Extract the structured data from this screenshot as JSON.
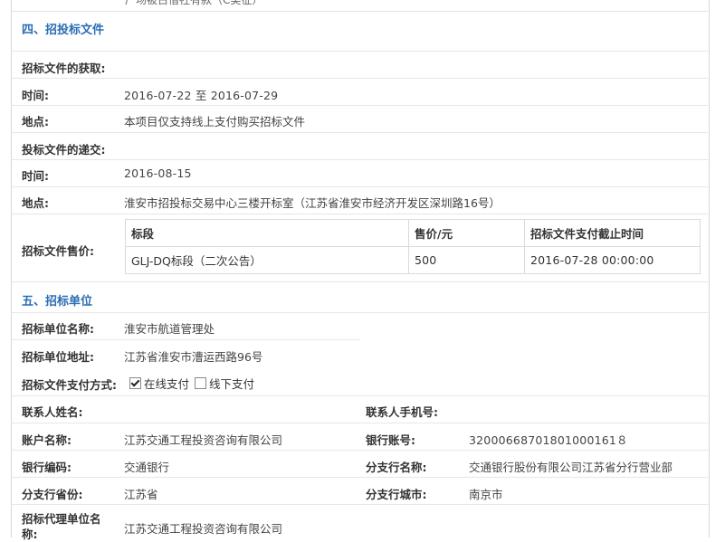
{
  "top_partial": "广场被占借社有款（C类征）",
  "section4": {
    "title": "四、招投标文件",
    "rows": {
      "get_label": "招标文件的获取:",
      "time_label": "时间:",
      "time_value": "2016-07-22 至 2016-07-29",
      "place_label": "地点:",
      "place_value": "本项目仅支持线上支付购买招标文件",
      "submit_label": "投标文件的递交:",
      "submit_time_label": "时间:",
      "submit_time_value": "2016-08-15",
      "submit_place_label": "地点:",
      "submit_place_value": "淮安市招投标交易中心三楼开标室（江苏省淮安市经济开发区深圳路16号）",
      "price_label": "招标文件售价:"
    },
    "fee_table": {
      "headers": [
        "标段",
        "售价/元",
        "招标文件支付截止时间"
      ],
      "rows": [
        [
          "GLJ-DQ标段（二次公告）",
          "500",
          "2016-07-28 00:00:00"
        ]
      ]
    }
  },
  "section5": {
    "title": "五、招标单位",
    "unit_name_label": "招标单位名称:",
    "unit_name_value": "淮安市航道管理处",
    "unit_addr_label": "招标单位地址:",
    "unit_addr_value": "江苏省淮安市漕运西路96号",
    "pay_label": "招标文件支付方式:",
    "pay_online": "在线支付",
    "pay_offline": "线下支付",
    "contact_label": "联系人姓名:",
    "phone_label": "联系人手机号:",
    "account_name_label": "账户名称:",
    "account_name_value": "江苏交通工程投资咨询有限公司",
    "bank_acct_label": "银行账号:",
    "bank_acct_value": "32000668701801000161８",
    "bank_code_label": "银行编码:",
    "bank_code_value": "交通银行",
    "branch_name_label": "分支行名称:",
    "branch_name_value": "交通银行股份有限公司江苏省分行营业部",
    "branch_prov_label": "分支行省份:",
    "branch_prov_value": "江苏省",
    "branch_city_label": "分支行城市:",
    "branch_city_value": "南京市",
    "agent_label": "招标代理单位名称:",
    "agent_value": "江苏交通工程投资咨询有限公司"
  }
}
